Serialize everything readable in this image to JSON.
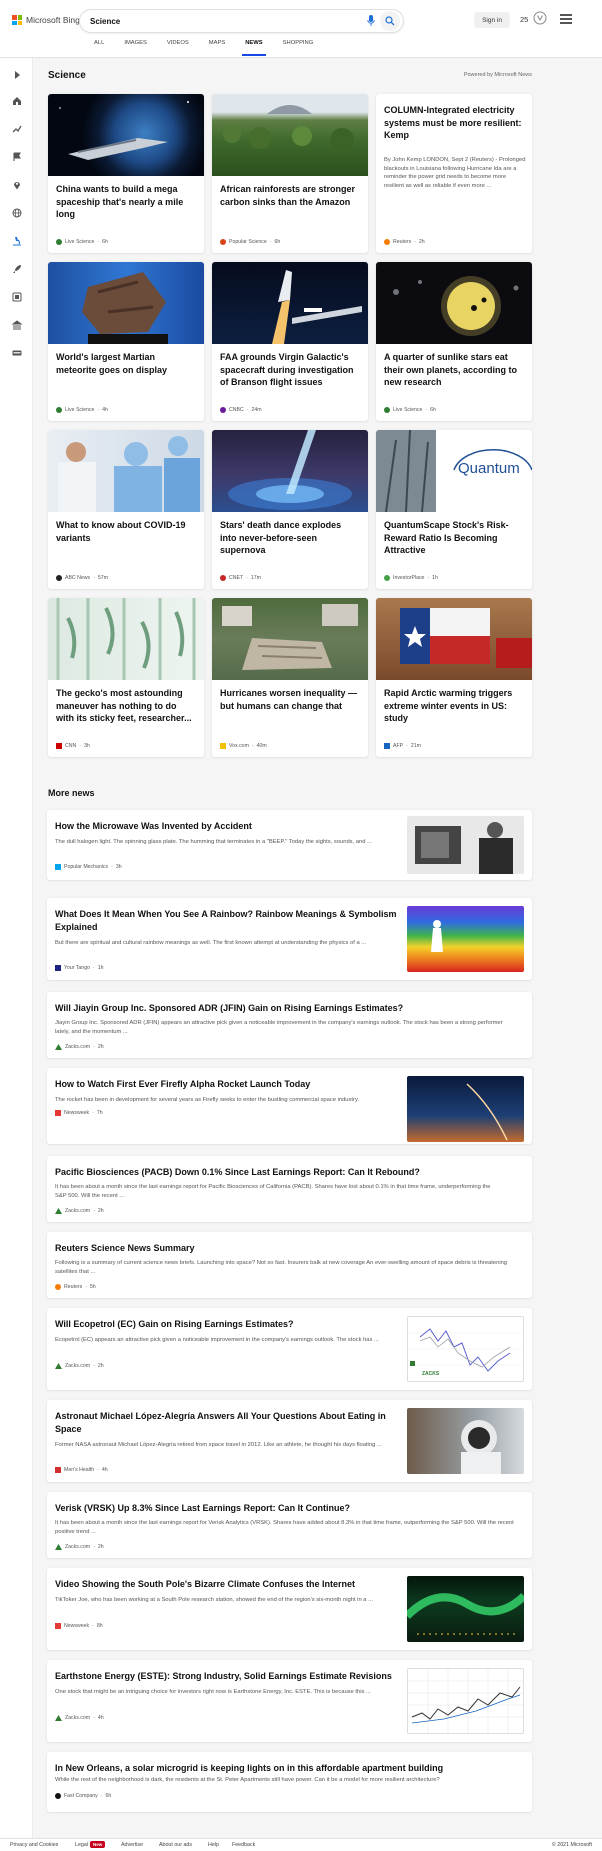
{
  "header": {
    "brand": "Microsoft Bing",
    "search_value": "Science",
    "signin_label": "Sign in",
    "points": "25"
  },
  "nav": {
    "tabs": [
      {
        "label": "ALL"
      },
      {
        "label": "IMAGES"
      },
      {
        "label": "VIDEOS"
      },
      {
        "label": "MAPS"
      },
      {
        "label": "NEWS",
        "active": true
      },
      {
        "label": "SHOPPING"
      }
    ]
  },
  "rail": {
    "icons": [
      "expand-icon",
      "home-icon",
      "trending-icon",
      "flag-icon",
      "location-pin-icon",
      "globe-icon",
      "microscope-icon",
      "rocket-icon",
      "entertainment-icon",
      "finance-icon",
      "money-icon"
    ]
  },
  "section": {
    "title": "Science",
    "powered_by": "Powered by Microsoft News"
  },
  "cards": [
    {
      "title": "China wants to build a mega spaceship that's nearly a mile long",
      "source": "Live Science",
      "time": "6h",
      "src_color": "#2e7d32"
    },
    {
      "title": "African rainforests are stronger carbon sinks than the Amazon",
      "source": "Popular Science",
      "time": "6h",
      "src_color": "#d84315"
    },
    {
      "title": "COLUMN-Integrated electricity systems must be more resilient: Kemp",
      "body": "By John Kemp LONDON, Sept 2 (Reuters) - Prolonged blackouts in Louisiana following Hurricane Ida are a reminder the power grid needs to become more resilient as well as reliable if even more ...",
      "source": "Reuters",
      "time": "2h",
      "src_color": "#f57c00"
    },
    {
      "title": "World's largest Martian meteorite goes on display",
      "source": "Live Science",
      "time": "4h",
      "src_color": "#2e7d32"
    },
    {
      "title": "FAA grounds Virgin Galactic's spacecraft during investigation of Branson flight issues",
      "source": "CNBC",
      "time": "24m",
      "src_color": "#6a1b9a"
    },
    {
      "title": "A quarter of sunlike stars eat their own planets, according to new research",
      "source": "Live Science",
      "time": "6h",
      "src_color": "#2e7d32"
    },
    {
      "title": "What to know about COVID-19 variants",
      "source": "ABC News",
      "time": "57m",
      "src_color": "#222222"
    },
    {
      "title": "Stars' death dance explodes into never-before-seen supernova",
      "source": "CNET",
      "time": "17m",
      "src_color": "#c62828"
    },
    {
      "title": "QuantumScape Stock's Risk-Reward Ratio Is Becoming Attractive",
      "source": "InvestorPlace",
      "time": "1h",
      "src_color": "#43a047"
    },
    {
      "title": "The gecko's most astounding maneuver has nothing to do with its sticky feet, researcher...",
      "source": "CNN",
      "time": "3h",
      "src_color": "#cc0000"
    },
    {
      "title": "Hurricanes worsen inequality — but humans can change that",
      "source": "Vox.com",
      "time": "40m",
      "src_color": "#f2c200"
    },
    {
      "title": "Rapid Arctic warming triggers extreme winter events in US: study",
      "source": "AFP",
      "time": "21m",
      "src_color": "#1565c0"
    }
  ],
  "quantum_logo_text": "Quantum",
  "more_news": {
    "title": "More news",
    "items": [
      {
        "title": "How the Microwave Was Invented by Accident",
        "body": "The dull halogen light. The spinning glass plate. The humming that terminates in a \"BEEP.\" Today the sights, sounds, and ...",
        "source": "Popular Mechanics",
        "time": "3h",
        "src_color": "#00a4ef"
      },
      {
        "title": "What Does It Mean When You See A Rainbow? Rainbow Meanings & Symbolism Explained",
        "body": "But there are spiritual and cultural rainbow meanings as well. The first known attempt at understanding the physics of a ...",
        "source": "Your Tango",
        "time": "1h",
        "src_color": "#1a237e"
      },
      {
        "title": "Will Jiayin Group Inc. Sponsored ADR (JFIN) Gain on Rising Earnings Estimates?",
        "body": "Jiayin Group Inc. Sponsored ADR (JFIN) appears an attractive pick given a noticeable improvement in the company's earnings outlook. The stock has been a strong performer lately, and the momentum ...",
        "source": "Zacks.com",
        "time": "2h",
        "src_color": "#2e7d32"
      },
      {
        "title": "How to Watch First Ever Firefly Alpha Rocket Launch Today",
        "body": "The rocket has been in development for several years as Firefly seeks to enter the bustling commercial space industry.",
        "source": "Newsweek",
        "time": "7h",
        "src_color": "#e53935"
      },
      {
        "title": "Pacific Biosciences (PACB) Down 0.1% Since Last Earnings Report: Can It Rebound?",
        "body": "It has been about a month since the last earnings report for Pacific Biosciences of California (PACB). Shares have lost about 0.1% in that time frame, underperforming the S&P 500. Will the recent ...",
        "source": "Zacks.com",
        "time": "2h",
        "src_color": "#2e7d32"
      },
      {
        "title": "Reuters Science News Summary",
        "body": "Following is a summary of current science news briefs. Launching into space? Not so fast. Insurers balk at new coverage An ever-swelling amount of space debris is threatening satellites that ...",
        "source": "Reuters",
        "time": "5h",
        "src_color": "#f57c00"
      },
      {
        "title": "Will Ecopetrol (EC) Gain on Rising Earnings Estimates?",
        "body": "Ecopetrol (EC) appears an attractive pick given a noticeable improvement in the company's earnings outlook. The stock has ...",
        "source": "Zacks.com",
        "time": "2h",
        "src_color": "#2e7d32"
      },
      {
        "title": "Astronaut Michael López-Alegría Answers All Your Questions About Eating in Space",
        "body": "Former NASA astronaut Michael López-Alegría retired from space travel in 2012. Like an athlete, he thought his days floating ...",
        "source": "Men's Health",
        "time": "4h",
        "src_color": "#d32f2f"
      },
      {
        "title": "Verisk (VRSK) Up 8.3% Since Last Earnings Report: Can It Continue?",
        "body": "It has been about a month since the last earnings report for Verisk Analytics (VRSK). Shares have added about 8.3% in that time frame, outperforming the S&P 500. Will the recent positive trend ...",
        "source": "Zacks.com",
        "time": "2h",
        "src_color": "#2e7d32"
      },
      {
        "title": "Video Showing the South Pole's Bizarre Climate Confuses the Internet",
        "body": "TikToker Joe, who has been working at a South Pole research station, showed the end of the region's six-month night in a ...",
        "source": "Newsweek",
        "time": "8h",
        "src_color": "#e53935"
      },
      {
        "title": "Earthstone Energy (ESTE): Strong Industry, Solid Earnings Estimate Revisions",
        "body": "One stock that might be an intriguing choice for investors right now is Earthstone Energy, Inc. ESTE. This is because this ...",
        "source": "Zacks.com",
        "time": "4h",
        "src_color": "#2e7d32"
      },
      {
        "title": "In New Orleans, a solar microgrid is keeping lights on in this affordable apartment building",
        "body": "While the rest of the neighborhood is dark, the residents at the St. Peter Apartments still have power. Can it be a model for more resilient architecture?",
        "source": "Fast Company",
        "time": "6h",
        "src_color": "#111111"
      }
    ]
  },
  "zacks_thumb_label": "ZACKS",
  "footer": {
    "privacy": "Privacy and Cookies",
    "legal": "Legal",
    "new_badge": "New",
    "advertise": "Advertise",
    "about_ads": "About our ads",
    "help": "Help",
    "feedback": "Feedback",
    "copyright": "© 2021 Microsoft"
  }
}
